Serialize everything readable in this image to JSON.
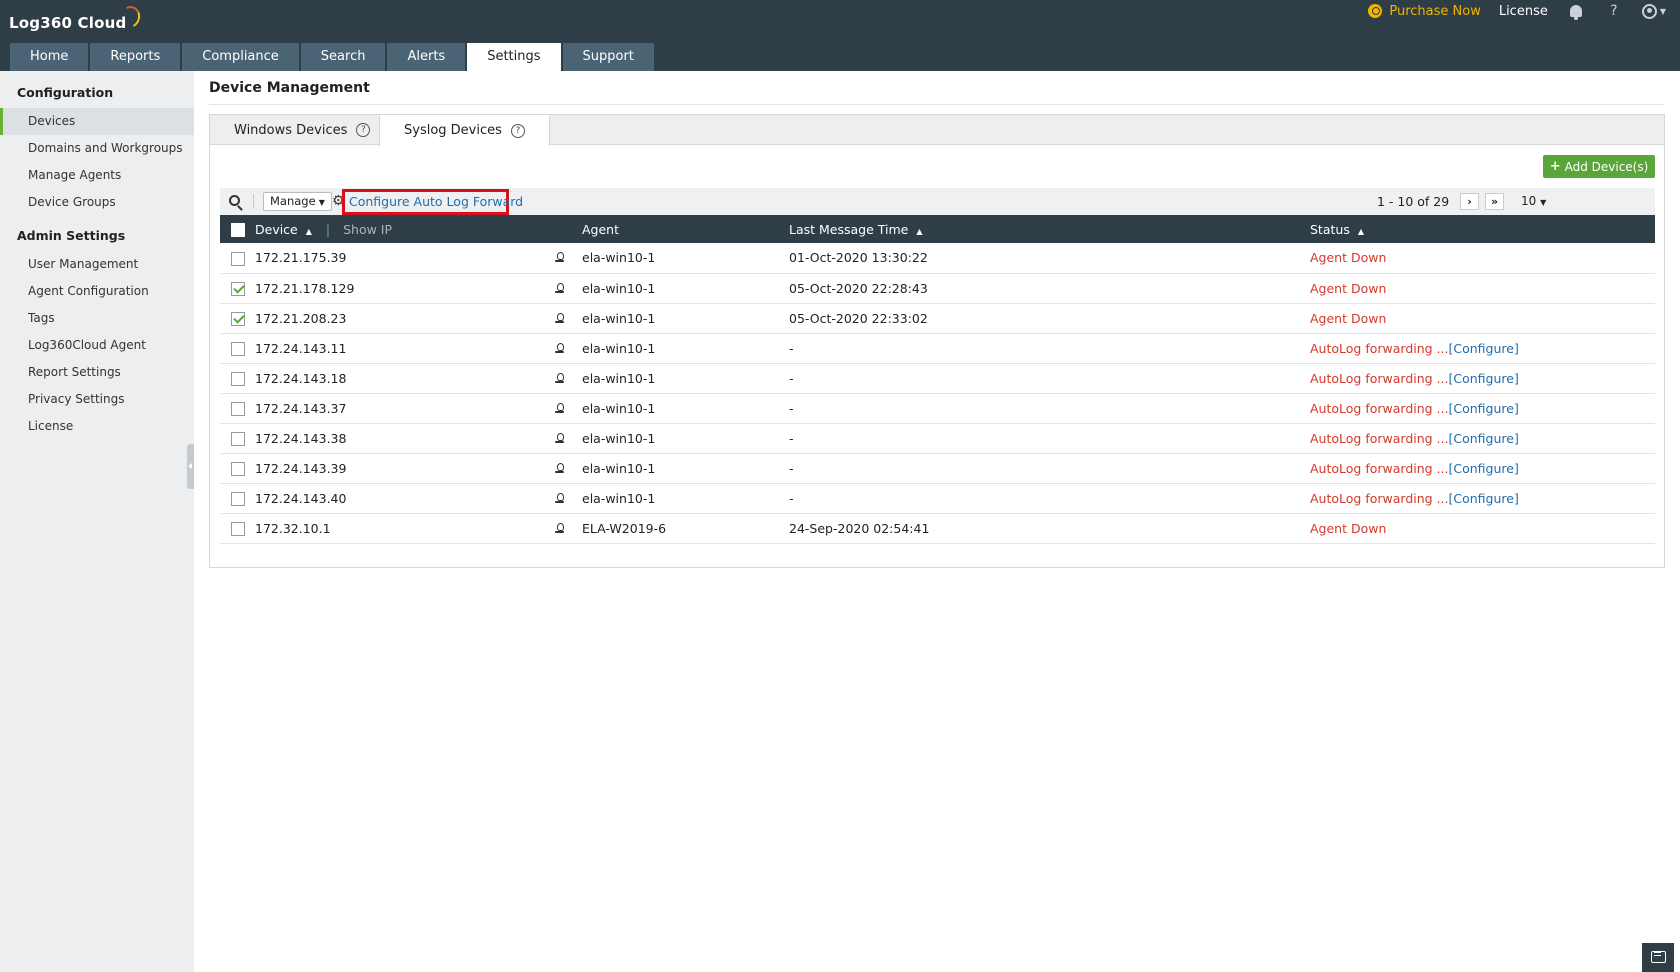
{
  "app": {
    "logo_text": "Log360 Cloud",
    "purchase_label": "Purchase Now",
    "license_label": "License",
    "help_label": "?"
  },
  "tabs": [
    {
      "label": "Home"
    },
    {
      "label": "Reports"
    },
    {
      "label": "Compliance"
    },
    {
      "label": "Search"
    },
    {
      "label": "Alerts"
    },
    {
      "label": "Settings",
      "active": true
    },
    {
      "label": "Support"
    }
  ],
  "sidebar": {
    "config_heading": "Configuration",
    "config_items": [
      {
        "label": "Devices",
        "active": true
      },
      {
        "label": "Domains and Workgroups"
      },
      {
        "label": "Manage Agents"
      },
      {
        "label": "Device Groups"
      }
    ],
    "admin_heading": "Admin Settings",
    "admin_items": [
      {
        "label": "User Management"
      },
      {
        "label": "Agent Configuration"
      },
      {
        "label": "Tags"
      },
      {
        "label": "Log360Cloud Agent"
      },
      {
        "label": "Report Settings"
      },
      {
        "label": "Privacy Settings"
      },
      {
        "label": "License"
      }
    ]
  },
  "main": {
    "title": "Device Management",
    "subtabs": [
      {
        "label": "Windows Devices"
      },
      {
        "label": "Syslog Devices",
        "active": true
      }
    ],
    "help_glyph": "?",
    "add_button": "Add Device(s)",
    "toolbar": {
      "manage_label": "Manage",
      "configure_link": "Configure Auto Log Forward",
      "pager_text": "1 - 10 of 29",
      "next_glyph": "›",
      "last_glyph": "»",
      "per_page": "10"
    },
    "columns": {
      "device": "Device",
      "show_ip": "Show IP",
      "agent": "Agent",
      "last_message_time": "Last Message Time",
      "status": "Status"
    },
    "rows": [
      {
        "device": "172.21.175.39",
        "agent": "ela-win10-1",
        "time": "01-Oct-2020 13:30:22",
        "status": "Agent Down",
        "checked": false,
        "configure": ""
      },
      {
        "device": "172.21.178.129",
        "agent": "ela-win10-1",
        "time": "05-Oct-2020 22:28:43",
        "status": "Agent Down",
        "checked": true,
        "configure": ""
      },
      {
        "device": "172.21.208.23",
        "agent": "ela-win10-1",
        "time": "05-Oct-2020 22:33:02",
        "status": "Agent Down",
        "checked": true,
        "configure": ""
      },
      {
        "device": "172.24.143.11",
        "agent": "ela-win10-1",
        "time": "-",
        "status": "AutoLog forwarding ...",
        "checked": false,
        "configure": "[Configure]"
      },
      {
        "device": "172.24.143.18",
        "agent": "ela-win10-1",
        "time": "-",
        "status": "AutoLog forwarding ...",
        "checked": false,
        "configure": "[Configure]"
      },
      {
        "device": "172.24.143.37",
        "agent": "ela-win10-1",
        "time": "-",
        "status": "AutoLog forwarding ...",
        "checked": false,
        "configure": "[Configure]"
      },
      {
        "device": "172.24.143.38",
        "agent": "ela-win10-1",
        "time": "-",
        "status": "AutoLog forwarding ...",
        "checked": false,
        "configure": "[Configure]"
      },
      {
        "device": "172.24.143.39",
        "agent": "ela-win10-1",
        "time": "-",
        "status": "AutoLog forwarding ...",
        "checked": false,
        "configure": "[Configure]"
      },
      {
        "device": "172.24.143.40",
        "agent": "ela-win10-1",
        "time": "-",
        "status": "AutoLog forwarding ...",
        "checked": false,
        "configure": "[Configure]"
      },
      {
        "device": "172.32.10.1",
        "agent": "ELA-W2019-6",
        "time": "24-Sep-2020 02:54:41",
        "status": "Agent Down",
        "checked": false,
        "configure": ""
      }
    ]
  },
  "colors": {
    "header_bg": "#2f3d47",
    "tab_bg": "#4a6476",
    "accent_green": "#5aa63a",
    "status_red": "#d33a2c",
    "link_blue": "#1f6cb0",
    "highlight_red": "#d8101c",
    "purchase_gold": "#f2b400"
  }
}
